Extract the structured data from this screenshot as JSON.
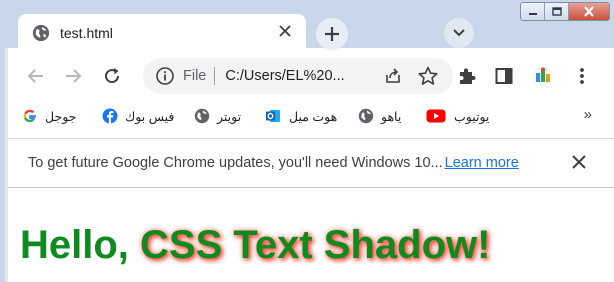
{
  "window": {
    "controls": [
      "minimize-icon",
      "maximize-icon",
      "close-icon"
    ]
  },
  "tab": {
    "title": "test.html",
    "close_icon": "close-icon",
    "favicon": "globe-icon"
  },
  "tabstrip": {
    "new_tab_icon": "plus-icon",
    "search_tabs_icon": "chevron-down-icon"
  },
  "toolbar": {
    "back_icon": "arrow-left-icon",
    "forward_icon": "arrow-right-icon",
    "reload_icon": "reload-icon",
    "scheme": "File",
    "url": "C:/Users/EL%20...",
    "extensions_icon": "puzzle-icon",
    "side_panel_icon": "side-panel-icon",
    "menu_icon": "kebab-menu-icon"
  },
  "bookmarks": [
    {
      "label": "جوجل",
      "icon": "google-icon"
    },
    {
      "label": "فيس بوك",
      "icon": "facebook-icon"
    },
    {
      "label": "تويتر",
      "icon": "globe-icon"
    },
    {
      "label": "هوت ميل",
      "icon": "outlook-icon"
    },
    {
      "label": "ياهو",
      "icon": "globe-icon"
    },
    {
      "label": "يوتيوب",
      "icon": "youtube-icon"
    }
  ],
  "bookmarks_more": "»",
  "infobar": {
    "message": "To get future Google Chrome updates, you'll need Windows 10...",
    "link": "Learn more"
  },
  "page": {
    "heading_plain": "Hello, ",
    "heading_shadow": "CSS Text Shadow!",
    "text_color": "#0f8a1f",
    "shadow_color": "#ff3b2b"
  }
}
